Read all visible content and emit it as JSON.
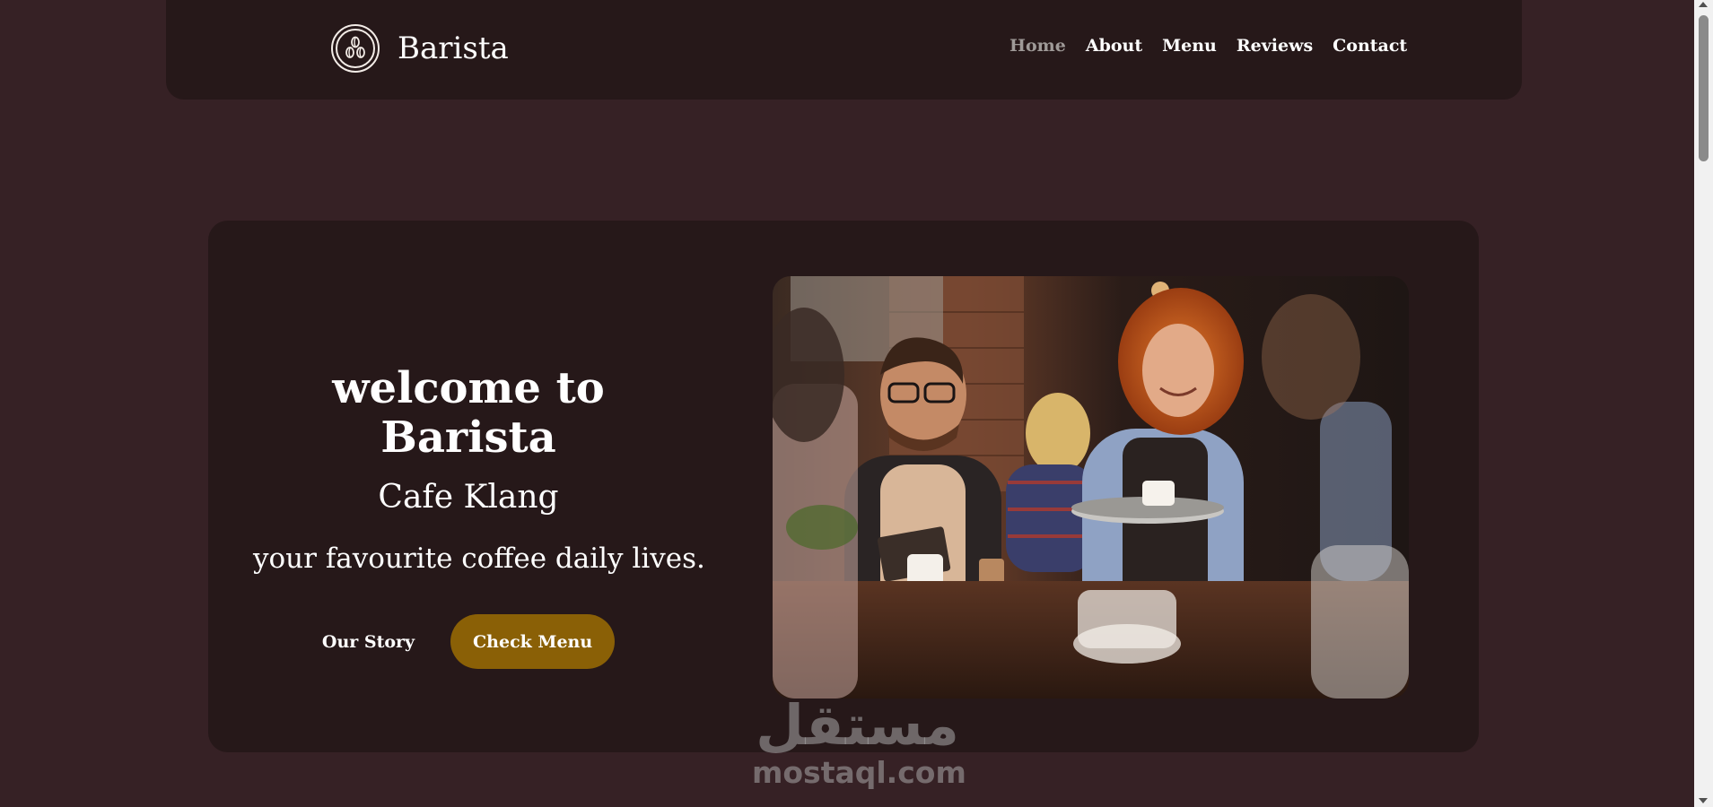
{
  "brand": {
    "name": "Barista",
    "logo_icon": "coffee-beans-icon"
  },
  "nav": {
    "items": [
      {
        "label": "Home",
        "active": true
      },
      {
        "label": "About",
        "active": false
      },
      {
        "label": "Menu",
        "active": false
      },
      {
        "label": "Reviews",
        "active": false
      },
      {
        "label": "Contact",
        "active": false
      }
    ]
  },
  "hero": {
    "title": "welcome to Barista",
    "subtitle": "Cafe Klang",
    "tagline": "your favourite coffee daily lives.",
    "secondary_button": "Our Story",
    "primary_button": "Check Menu",
    "image_subject": "barista serving coffee to customers in a cafe"
  },
  "watermark": {
    "arabic": "مستقل",
    "latin": "mostaql.com"
  },
  "colors": {
    "page_bg": "#362125",
    "card_bg": "#261819",
    "accent": "#8a6006",
    "nav_active": "#9f9a98"
  }
}
